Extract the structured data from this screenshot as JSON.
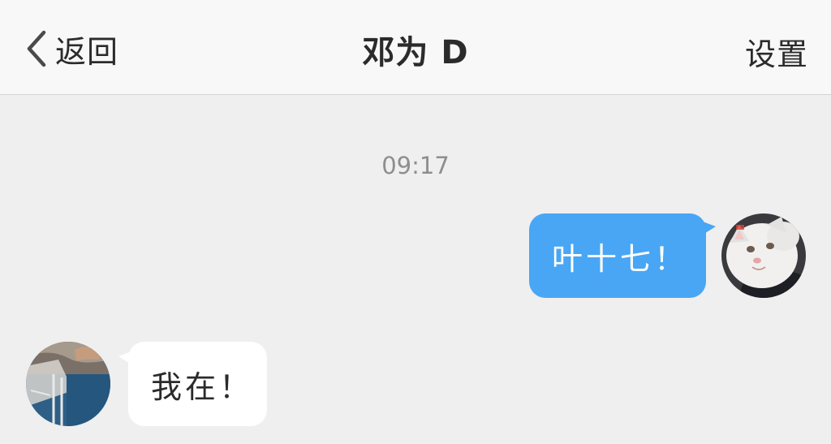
{
  "nav": {
    "back_label": "返回",
    "title": "邓为 D",
    "settings_label": "设置",
    "back_icon": "chevron-left-icon"
  },
  "chat": {
    "timestamp": "09:17",
    "messages": [
      {
        "direction": "outgoing",
        "text": "叶十七！"
      },
      {
        "direction": "incoming",
        "text": "我在！"
      }
    ]
  },
  "colors": {
    "nav_background": "#f8f8f8",
    "chat_background": "#efefef",
    "outgoing_bubble": "#48a6f5",
    "incoming_bubble": "#ffffff",
    "timestamp_text": "#8e8e8e"
  }
}
